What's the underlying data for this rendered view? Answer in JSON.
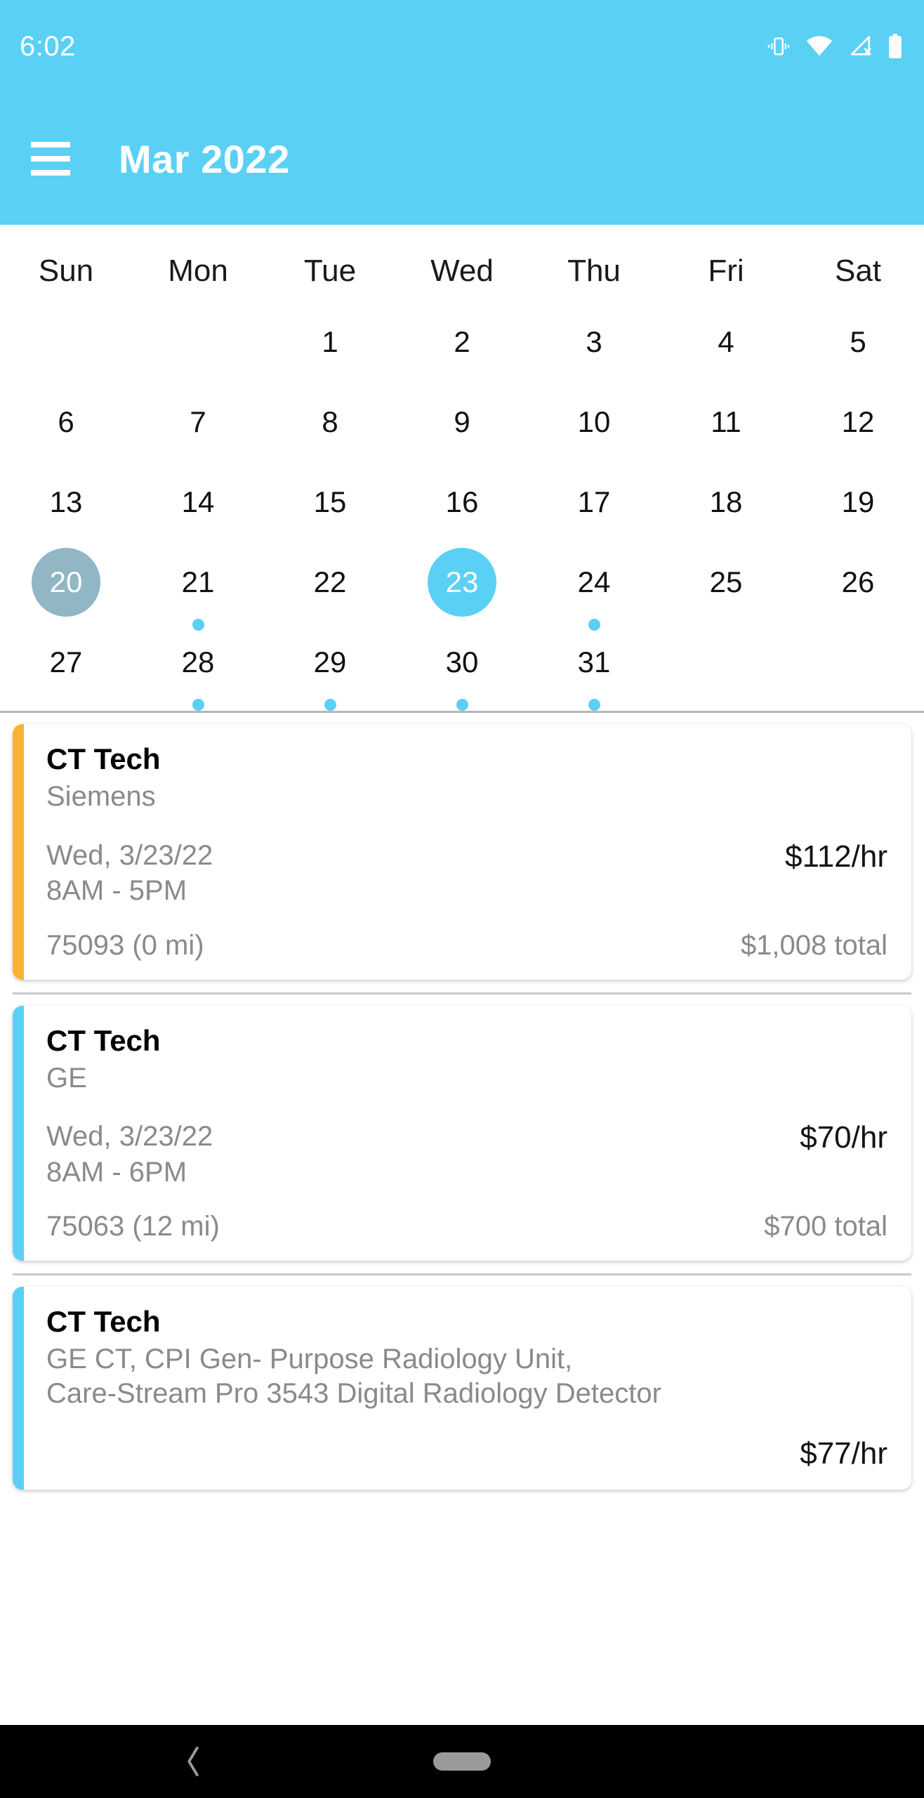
{
  "status_bar": {
    "time": "6:02",
    "icons": [
      "vibrate-icon",
      "wifi-icon",
      "cellular-no-signal-icon",
      "battery-icon"
    ]
  },
  "app_bar": {
    "menu_label": "menu",
    "title": "Mar 2022",
    "background_color": "#5BD0F5"
  },
  "calendar": {
    "weekdays": [
      "Sun",
      "Mon",
      "Tue",
      "Wed",
      "Thu",
      "Fri",
      "Sat"
    ],
    "today_color": "#91B6C4",
    "selected_color": "#5BD0F5",
    "dot_color": "#5BD0F5",
    "weeks": [
      [
        {
          "label": "",
          "empty": true,
          "dot": false,
          "state": "none"
        },
        {
          "label": "",
          "empty": true,
          "dot": false,
          "state": "none"
        },
        {
          "label": "1",
          "empty": false,
          "dot": false,
          "state": "none"
        },
        {
          "label": "2",
          "empty": false,
          "dot": false,
          "state": "none"
        },
        {
          "label": "3",
          "empty": false,
          "dot": false,
          "state": "none"
        },
        {
          "label": "4",
          "empty": false,
          "dot": false,
          "state": "none"
        },
        {
          "label": "5",
          "empty": false,
          "dot": false,
          "state": "none"
        }
      ],
      [
        {
          "label": "6",
          "empty": false,
          "dot": false,
          "state": "none"
        },
        {
          "label": "7",
          "empty": false,
          "dot": false,
          "state": "none"
        },
        {
          "label": "8",
          "empty": false,
          "dot": false,
          "state": "none"
        },
        {
          "label": "9",
          "empty": false,
          "dot": false,
          "state": "none"
        },
        {
          "label": "10",
          "empty": false,
          "dot": false,
          "state": "none"
        },
        {
          "label": "11",
          "empty": false,
          "dot": false,
          "state": "none"
        },
        {
          "label": "12",
          "empty": false,
          "dot": false,
          "state": "none"
        }
      ],
      [
        {
          "label": "13",
          "empty": false,
          "dot": false,
          "state": "none"
        },
        {
          "label": "14",
          "empty": false,
          "dot": false,
          "state": "none"
        },
        {
          "label": "15",
          "empty": false,
          "dot": false,
          "state": "none"
        },
        {
          "label": "16",
          "empty": false,
          "dot": false,
          "state": "none"
        },
        {
          "label": "17",
          "empty": false,
          "dot": false,
          "state": "none"
        },
        {
          "label": "18",
          "empty": false,
          "dot": false,
          "state": "none"
        },
        {
          "label": "19",
          "empty": false,
          "dot": false,
          "state": "none"
        }
      ],
      [
        {
          "label": "20",
          "empty": false,
          "dot": false,
          "state": "today"
        },
        {
          "label": "21",
          "empty": false,
          "dot": true,
          "state": "none"
        },
        {
          "label": "22",
          "empty": false,
          "dot": false,
          "state": "none"
        },
        {
          "label": "23",
          "empty": false,
          "dot": false,
          "state": "selected"
        },
        {
          "label": "24",
          "empty": false,
          "dot": true,
          "state": "none"
        },
        {
          "label": "25",
          "empty": false,
          "dot": false,
          "state": "none"
        },
        {
          "label": "26",
          "empty": false,
          "dot": false,
          "state": "none"
        }
      ],
      [
        {
          "label": "27",
          "empty": false,
          "dot": false,
          "state": "none"
        },
        {
          "label": "28",
          "empty": false,
          "dot": true,
          "state": "none"
        },
        {
          "label": "29",
          "empty": false,
          "dot": true,
          "state": "none"
        },
        {
          "label": "30",
          "empty": false,
          "dot": true,
          "state": "none"
        },
        {
          "label": "31",
          "empty": false,
          "dot": true,
          "state": "none"
        },
        {
          "label": "",
          "empty": true,
          "dot": false,
          "state": "none"
        },
        {
          "label": "",
          "empty": true,
          "dot": false,
          "state": "none"
        }
      ]
    ]
  },
  "events": [
    {
      "title": "CT Tech",
      "subtitle": "Siemens",
      "date": "Wed, 3/23/22",
      "time": "8AM - 5PM",
      "rate": "$112/hr",
      "location": "75093 (0 mi)",
      "total": "$1,008 total",
      "accent_color": "#F9B233"
    },
    {
      "title": "CT Tech",
      "subtitle": "GE",
      "date": "Wed, 3/23/22",
      "time": "8AM - 6PM",
      "rate": "$70/hr",
      "location": "75063 (12 mi)",
      "total": "$700 total",
      "accent_color": "#5BD0F5"
    },
    {
      "title": "CT Tech",
      "subtitle": "GE CT, CPI Gen- Purpose Radiology Unit,\nCare-Stream Pro 3543 Digital Radiology Detector",
      "date": "",
      "time": "",
      "rate": "$77/hr",
      "location": "",
      "total": "",
      "accent_color": "#5BD0F5"
    }
  ],
  "nav_bar": {
    "back_label": "back",
    "home_label": "home"
  }
}
